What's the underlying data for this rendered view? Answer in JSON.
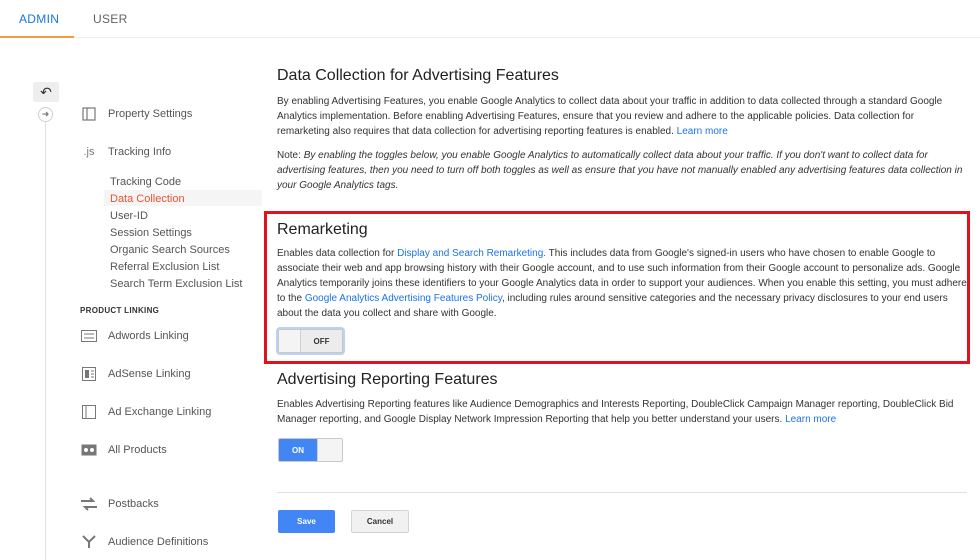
{
  "tabs": {
    "admin": "ADMIN",
    "user": "USER"
  },
  "sidebar": {
    "property_settings": "Property Settings",
    "tracking_info": "Tracking Info",
    "js_glyph": ".js",
    "sub_items": [
      "Tracking Code",
      "Data Collection",
      "User-ID",
      "Session Settings",
      "Organic Search Sources",
      "Referral Exclusion List",
      "Search Term Exclusion List"
    ],
    "active_sub_item": "Data Collection",
    "product_linking_label": "PRODUCT LINKING",
    "adwords_linking": "Adwords Linking",
    "adsense_linking": "AdSense Linking",
    "ad_exchange_linking": "Ad Exchange Linking",
    "all_products": "All Products",
    "postbacks": "Postbacks",
    "audience_definitions": "Audience Definitions"
  },
  "main": {
    "title": "Data Collection for Advertising Features",
    "intro": "By enabling Advertising Features, you enable Google Analytics to collect data about your traffic in addition to data collected through a standard Google Analytics implementation. Before enabling Advertising Features, ensure that you review and adhere to the applicable policies. Data collection for remarketing also requires that data collection for advertising reporting features is enabled.",
    "intro_link": "Learn more",
    "note_label": "Note:",
    "note": "By enabling the toggles below, you enable Google Analytics to automatically collect data about your traffic. If you don't want to collect data for advertising features, then you need to turn off both toggles as well as ensure that you have not manually enabled any advertising features data collection in your Google Analytics tags.",
    "remarketing": {
      "title": "Remarketing",
      "text_pre": "Enables data collection for",
      "link1": "Display and Search Remarketing.",
      "text_mid": "This includes data from Google's signed-in users who have chosen to enable Google to associate their web and app browsing history with their Google account, and to use such information from their Google account to personalize ads. Google Analytics temporarily joins these identifiers to your Google Analytics data in order to support your audiences. When you enable this setting, you must adhere to the",
      "link2": "Google Analytics Advertising Features Policy",
      "text_post": ", including rules around sensitive categories and the necessary privacy disclosures to your end users about the data you collect and share with Google.",
      "toggle_label": "OFF"
    },
    "reporting": {
      "title": "Advertising Reporting Features",
      "text": "Enables Advertising Reporting features like Audience Demographics and Interests Reporting, DoubleClick Campaign Manager reporting, DoubleClick Bid Manager reporting, and Google Display Network Impression Reporting that help you better understand your users.",
      "link": "Learn more",
      "toggle_label": "ON"
    },
    "save_label": "Save",
    "cancel_label": "Cancel"
  },
  "colors": {
    "accent": "#4285f4",
    "link": "#1a73e8",
    "active_nav": "#e8542f",
    "highlight": "#e0121e"
  }
}
